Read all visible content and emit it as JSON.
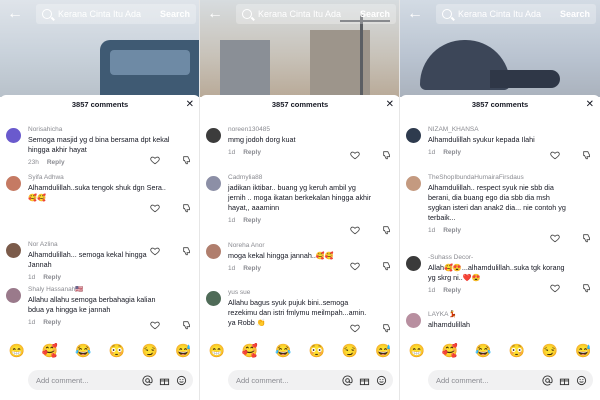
{
  "search": {
    "query": "Kerana Cinta Itu Ada",
    "button": "Search"
  },
  "comments_header": "3857 comments",
  "reply_label": "Reply",
  "add_comment_placeholder": "Add comment...",
  "emojis": [
    "😁",
    "🥰",
    "😂",
    "😳",
    "😏",
    "😅"
  ],
  "panels": [
    {
      "comments": [
        {
          "user": "Norisahicha",
          "text": "Semoga masjid yg d bina bersama dpt kekal hingga akhir hayat",
          "time": "23h",
          "avatar_color": "#6a5acd"
        },
        {
          "user": "Syifa Adhwa",
          "text": "Alhamdulillah..suka tengok shuk dgn Sera.. 🥰🥰",
          "time": "1d",
          "avatar_color": "#c57a63"
        },
        {
          "user": "Nor Azlina",
          "text": "Alhamdulillah... semoga kekal hingga Jannah",
          "time": "1d",
          "avatar_color": "#7b5b4a"
        },
        {
          "user": "Shaly Hassanah🇺🇸",
          "text": "Allahu allahu semoga berbahagia kalian bdua ya hingga ke jannah",
          "time": "1d",
          "avatar_color": "#9a7a8b"
        }
      ]
    },
    {
      "comments": [
        {
          "user": "noreen130485",
          "text": "mmg jodoh dorg kuat",
          "time": "1d",
          "avatar_color": "#3c3c3c"
        },
        {
          "user": "Cadmylia88",
          "text": "jadikan iktibar.. buang yg keruh ambil yg jernih .. moga ikatan berkekalan hingga akhir hayat,, aaaminn",
          "time": "1d",
          "avatar_color": "#8c8fa6"
        },
        {
          "user": "Noreha Anor",
          "text": "moga kekal hingga jannah..🥰🥰",
          "time": "1d",
          "avatar_color": "#b07e6d"
        },
        {
          "user": "yus sue",
          "text": "Allahu bagus syuk pujuk bini..semoga rezekimu dan istri fmlymu meilmpah...amin. ya Robb 👏",
          "time": "1d",
          "avatar_color": "#4f6b58"
        }
      ]
    },
    {
      "comments": [
        {
          "user": "NIZAM_KHANSA",
          "text": "Alhamdulillah syukur kepada Ilahi",
          "time": "1d",
          "avatar_color": "#2e3b4e"
        },
        {
          "user": "TheShopIbundaHumairaFirsdaus",
          "text": "Alhamdulillah.. respect syuk nie sbb dia berani, dia buang ego dia sbb dia msh sygkan isteri dan anak2 dia... nie contoh yg terbaik...",
          "time": "1d",
          "avatar_color": "#c49a80"
        },
        {
          "user": "-Suhass Decor-",
          "text": "Allah🥰😍...alhamdulillah..suka tgk korang yg skrg ni..❤️😍",
          "time": "1d",
          "avatar_color": "#3a3a3a"
        },
        {
          "user": "LAYKA💃",
          "text": "alhamdulillah",
          "time": "",
          "avatar_color": "#b88fa0"
        }
      ]
    }
  ]
}
